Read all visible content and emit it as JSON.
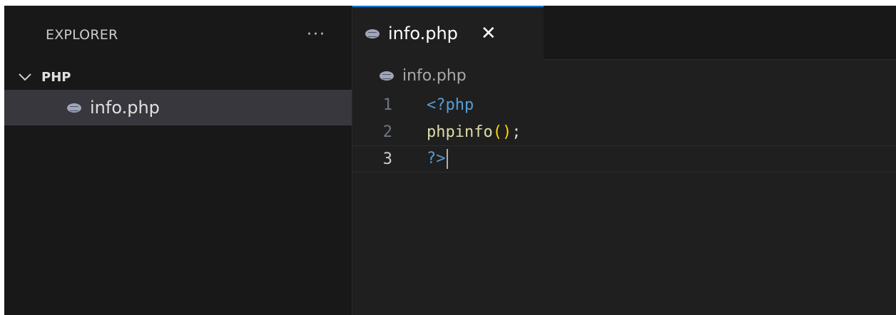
{
  "sidebar": {
    "title": "EXPLORER",
    "more": "···",
    "folder": {
      "name": "PHP"
    },
    "files": [
      {
        "name": "info.php"
      }
    ]
  },
  "editor": {
    "tab": {
      "label": "info.php",
      "close": "✕"
    },
    "breadcrumb": "info.php",
    "lines": [
      {
        "number": "1",
        "tokens": [
          {
            "t": "<?php",
            "c": "kw"
          }
        ]
      },
      {
        "number": "2",
        "tokens": [
          {
            "t": "phpinfo",
            "c": "fn"
          },
          {
            "t": "()",
            "c": "paren"
          },
          {
            "t": ";",
            "c": "punc"
          }
        ]
      },
      {
        "number": "3",
        "tokens": [
          {
            "t": "?>",
            "c": "kw"
          }
        ]
      }
    ],
    "current_line": 3
  },
  "colors": {
    "accent": "#0078d4",
    "keyword": "#569cd6",
    "function": "#dcdcaa",
    "bracket": "#ffd700"
  },
  "icons": {
    "file": "php-file-icon",
    "folder": "chevron-down-icon",
    "more": "more-icon",
    "close": "close-icon"
  }
}
